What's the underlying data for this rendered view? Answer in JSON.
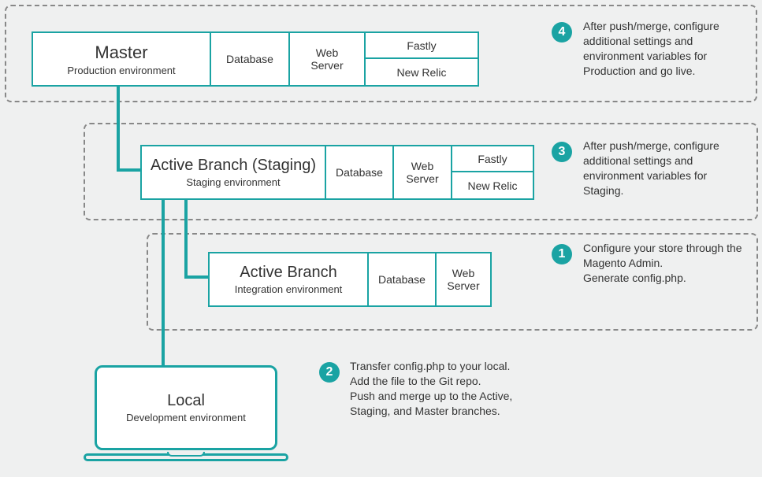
{
  "rows": [
    {
      "title": "Master",
      "subtitle": "Production environment",
      "cells": [
        "Database",
        "Web\nServer"
      ],
      "split": [
        "Fastly",
        "New Relic"
      ],
      "badge": "4",
      "note": "After push/merge, configure additional settings and environment variables for Production and go live."
    },
    {
      "title": "Active Branch (Staging)",
      "subtitle": "Staging environment",
      "cells": [
        "Database",
        "Web\nServer"
      ],
      "split": [
        "Fastly",
        "New Relic"
      ],
      "badge": "3",
      "note": "After push/merge, configure additional settings and environment variables for Staging."
    },
    {
      "title": "Active Branch",
      "subtitle": "Integration environment",
      "cells": [
        "Database",
        "Web\nServer"
      ],
      "badge": "1",
      "note": "Configure your store through the Magento Admin.\nGenerate config.php."
    }
  ],
  "local": {
    "title": "Local",
    "subtitle": "Development environment",
    "badge": "2",
    "note": "Transfer config.php to your local.\nAdd the file to the Git repo.\nPush and merge up to the Active, Staging, and Master branches."
  }
}
